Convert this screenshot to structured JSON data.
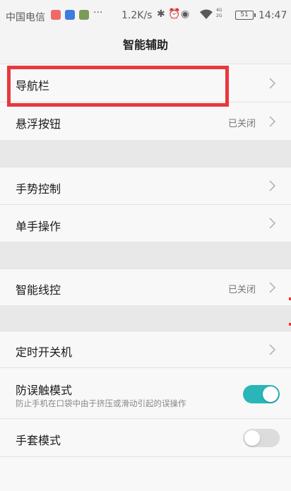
{
  "status_bar": {
    "carrier": "中国电信",
    "speed": "1.2K/s",
    "more": "···",
    "network": [
      "4G",
      "2G"
    ],
    "battery": "51",
    "time": "14:47",
    "icons": [
      "weibo-icon",
      "app-icon",
      "chart-icon",
      "bluetooth-icon",
      "alarm-icon",
      "eye-icon",
      "wifi-icon"
    ]
  },
  "header": {
    "title": "智能辅助"
  },
  "settings": [
    {
      "label": "导航栏",
      "value": "",
      "type": "link"
    },
    {
      "label": "悬浮按钮",
      "value": "已关闭",
      "type": "link"
    },
    {
      "label": "手势控制",
      "value": "",
      "type": "link"
    },
    {
      "label": "单手操作",
      "value": "",
      "type": "link"
    },
    {
      "label": "智能线控",
      "value": "已关闭",
      "type": "link"
    },
    {
      "label": "定时开关机",
      "value": "",
      "type": "link"
    },
    {
      "label": "防误触模式",
      "sub": "防止手机在口袋中由于挤压或滑动引起的误操作",
      "type": "toggle",
      "on": true
    },
    {
      "label": "手套模式",
      "type": "toggle",
      "on": false
    }
  ],
  "colors": {
    "accent": "#2ab5b8",
    "toggle_off": "#dcdcdc",
    "highlight": "#e8383d"
  }
}
